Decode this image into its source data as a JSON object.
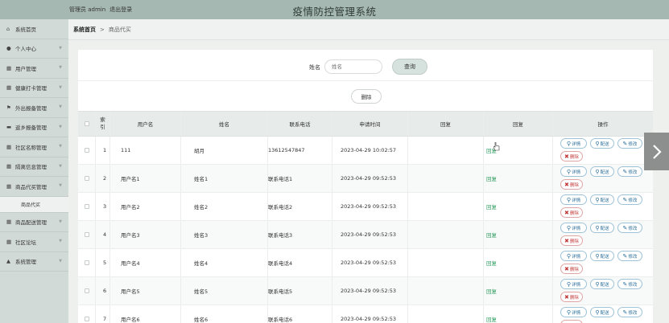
{
  "header": {
    "user_label": "管理员 admin",
    "logout": "退出登录",
    "title": "疫情防控管理系统"
  },
  "sidebar": {
    "items": [
      {
        "icon": "home-icon",
        "glyph": "⌂",
        "label": "系统首页",
        "chevron": false
      },
      {
        "icon": "user-icon",
        "glyph": "●",
        "label": "个人中心",
        "chevron": true
      },
      {
        "icon": "grid-icon",
        "glyph": "▦",
        "label": "用户管理",
        "chevron": true
      },
      {
        "icon": "grid-icon",
        "glyph": "▦",
        "label": "健康打卡管理",
        "chevron": true
      },
      {
        "icon": "flag-icon",
        "glyph": "⚑",
        "label": "外出报备管理",
        "chevron": true
      },
      {
        "icon": "chat-icon",
        "glyph": "▬",
        "label": "返乡报备管理",
        "chevron": true
      },
      {
        "icon": "grid-icon",
        "glyph": "▦",
        "label": "社区名称管理",
        "chevron": true
      },
      {
        "icon": "grid-icon",
        "glyph": "▦",
        "label": "隔离信息管理",
        "chevron": true
      },
      {
        "icon": "grid-icon",
        "glyph": "▦",
        "label": "商品代买管理",
        "chevron": true
      },
      {
        "icon": "grid-icon",
        "glyph": "▦",
        "label": "商品配送管理",
        "chevron": true
      },
      {
        "icon": "grid-icon",
        "glyph": "▦",
        "label": "社区论坛",
        "chevron": true
      },
      {
        "icon": "bank-icon",
        "glyph": "▲",
        "label": "系统管理",
        "chevron": true
      }
    ],
    "active_sub": "商品代买"
  },
  "breadcrumb": {
    "home": "系统首页",
    "separator": ">",
    "current": "商品代买"
  },
  "search": {
    "label": "姓名",
    "placeholder": "姓名",
    "query_button": "查询"
  },
  "delete_button": "删除",
  "table": {
    "headers": {
      "index_top": "索",
      "index_bottom": "引",
      "username": "用户名",
      "name": "姓名",
      "phone": "联系电话",
      "apply_time": "申请时间",
      "reply_col1": "回复",
      "reply_col2": "回复",
      "actions": "操作"
    },
    "reply_link": "回复",
    "actions": {
      "detail": "详情",
      "deliver": "配送",
      "edit": "修改",
      "delete": "删除"
    },
    "rows": [
      {
        "index": "1",
        "username": "111",
        "name": "胡月",
        "phone": "13612547847",
        "time": "2023-04-29 10:02:57"
      },
      {
        "index": "2",
        "username": "用户名1",
        "name": "姓名1",
        "phone": "联系电话1",
        "time": "2023-04-29 09:52:53"
      },
      {
        "index": "3",
        "username": "用户名2",
        "name": "姓名2",
        "phone": "联系电话2",
        "time": "2023-04-29 09:52:53"
      },
      {
        "index": "4",
        "username": "用户名3",
        "name": "姓名3",
        "phone": "联系电话3",
        "time": "2023-04-29 09:52:53"
      },
      {
        "index": "5",
        "username": "用户名4",
        "name": "姓名4",
        "phone": "联系电话4",
        "time": "2023-04-29 09:52:53"
      },
      {
        "index": "6",
        "username": "用户名5",
        "name": "姓名5",
        "phone": "联系电话5",
        "time": "2023-04-29 09:52:53"
      },
      {
        "index": "7",
        "username": "用户名6",
        "name": "姓名6",
        "phone": "联系电话6",
        "time": "2023-04-29 09:52:53"
      }
    ]
  },
  "colors": {
    "topbar": "#a6b8b2",
    "sidebar": "#d2dad7",
    "reply_green": "#2e9c60",
    "action_blue": "#2b6f9a",
    "delete_red": "#c23b3b"
  }
}
